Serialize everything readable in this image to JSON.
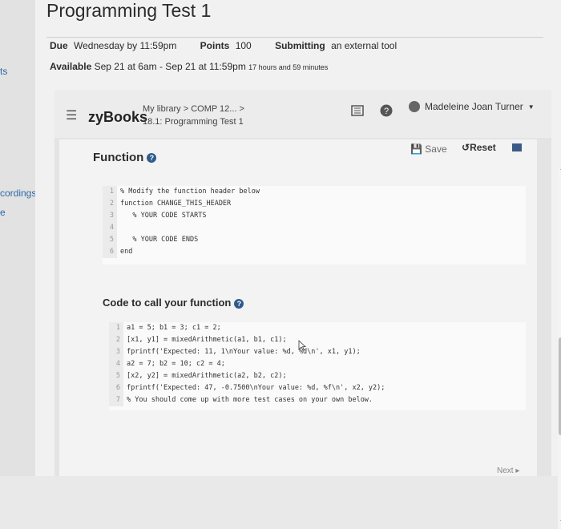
{
  "left_nav": {
    "items": [
      "ts",
      "cordings",
      "e"
    ]
  },
  "assignment": {
    "title": "Programming Test 1",
    "due_label": "Due",
    "due_value": "Wednesday by 11:59pm",
    "points_label": "Points",
    "points_value": "100",
    "submitting_label": "Submitting",
    "submitting_value": "an external tool",
    "available_label": "Available",
    "available_value": "Sep 21 at 6am - Sep 21 at 11:59pm",
    "available_extra": "17 hours and 59 minutes"
  },
  "zybooks": {
    "logo": "zyBooks",
    "breadcrumb_line1": "My library > COMP 12... >",
    "breadcrumb_line2": "18.1: Programming Test 1",
    "user_name": "Madeleine Joan Turner"
  },
  "function_section": {
    "title": "Function",
    "save_label": "Save",
    "reset_label": "Reset",
    "code": [
      {
        "n": "1",
        "t": "% Modify the function header below"
      },
      {
        "n": "2",
        "t": "function CHANGE_THIS_HEADER"
      },
      {
        "n": "3",
        "t": "   % YOUR CODE STARTS"
      },
      {
        "n": "4",
        "t": ""
      },
      {
        "n": "5",
        "t": "   % YOUR CODE ENDS"
      },
      {
        "n": "6",
        "t": "end"
      }
    ]
  },
  "call_section": {
    "title": "Code to call your function",
    "code": [
      {
        "n": "1",
        "t": "a1 = 5; b1 = 3; c1 = 2;"
      },
      {
        "n": "2",
        "t": "[x1, y1] = mixedArithmetic(a1, b1, c1);"
      },
      {
        "n": "3",
        "t": "fprintf('Expected: 11, 1\\nYour value: %d, %d\\n', x1, y1);"
      },
      {
        "n": "4",
        "t": "a2 = 7; b2 = 10; c2 = 4;"
      },
      {
        "n": "5",
        "t": "[x2, y2] = mixedArithmetic(a2, b2, c2);"
      },
      {
        "n": "6",
        "t": "fprintf('Expected: 47, -0.7500\\nYour value: %d, %f\\n', x2, y2);"
      },
      {
        "n": "7",
        "t": "% You should come up with more test cases on your own below."
      }
    ]
  },
  "footer": {
    "next_label": "Next"
  }
}
